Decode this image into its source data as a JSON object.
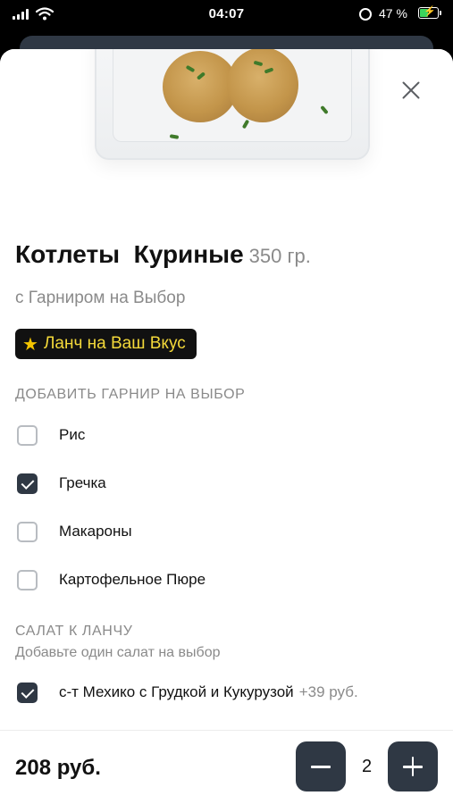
{
  "status_bar": {
    "time": "04:07",
    "battery": "47 %"
  },
  "product": {
    "title": "Котлеты  Куриные",
    "weight": "350 гр.",
    "subtitle": "с Гарниром на Выбор",
    "badge": "Ланч на Ваш Вкус"
  },
  "garnish_section": {
    "title": "ДОБАВИТЬ ГАРНИР НА ВЫБОР",
    "options": [
      {
        "label": "Рис",
        "checked": false
      },
      {
        "label": "Гречка",
        "checked": true
      },
      {
        "label": "Макароны",
        "checked": false
      },
      {
        "label": "Картофельное Пюре",
        "checked": false
      }
    ]
  },
  "salad_section": {
    "title": "САЛАТ К ЛАНЧУ",
    "subtitle": "Добавьте один салат на выбор",
    "options": [
      {
        "label": "с-т Мехико с Грудкой и Кукурузой",
        "price": "+39 руб.",
        "checked": true
      }
    ]
  },
  "footer": {
    "total": "208 руб.",
    "quantity": "2"
  },
  "colors": {
    "accent": "#2f3844",
    "badge_text": "#f4d93a",
    "muted": "#8a8a8a"
  }
}
